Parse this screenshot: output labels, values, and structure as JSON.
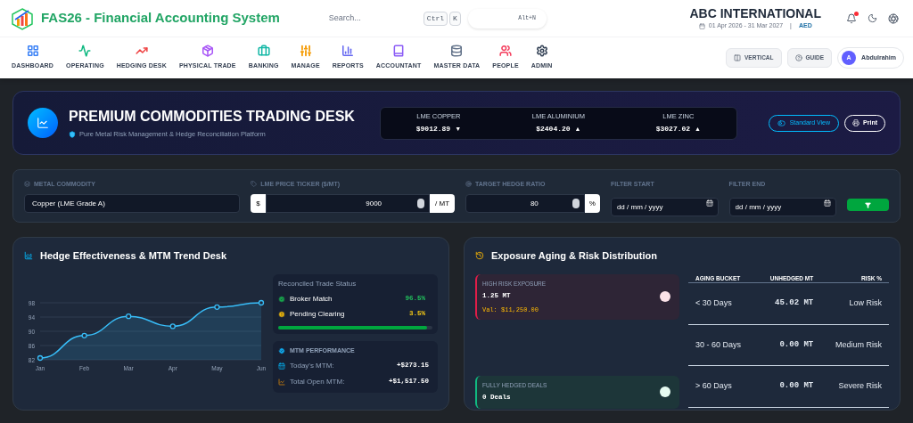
{
  "header": {
    "app_title": "FAS26 - Financial Accounting System",
    "search": {
      "placeholder": "Search...",
      "shortcut_keys": [
        "Ctrl",
        "K"
      ]
    },
    "quick_shortcut": "Alt+N",
    "company": "ABC INTERNATIONAL",
    "period": "01 Apr 2026 - 31 Mar 2027",
    "period_separator": "|",
    "currency": "AED",
    "has_notification": true
  },
  "nav": [
    {
      "label": "DASHBOARD",
      "color": "#3b82f6"
    },
    {
      "label": "OPERATING",
      "color": "#10b981"
    },
    {
      "label": "HEDGING DESK",
      "color": "#ef4444"
    },
    {
      "label": "PHYSICAL TRADE",
      "color": "#a855f7"
    },
    {
      "label": "BANKING",
      "color": "#14b8a6"
    },
    {
      "label": "MANAGE",
      "color": "#f59e0b"
    },
    {
      "label": "REPORTS",
      "color": "#6366f1"
    },
    {
      "label": "ACCOUNTANT",
      "color": "#8b5cf6"
    },
    {
      "label": "MASTER DATA",
      "color": "#64748b"
    },
    {
      "label": "PEOPLE",
      "color": "#f43f5e"
    },
    {
      "label": "ADMIN",
      "color": "#334155"
    }
  ],
  "nav_actions": {
    "vertical": "VERTICAL",
    "guide": "GUIDE",
    "user_initial": "A",
    "user_name": "Abdulrahim"
  },
  "hero": {
    "title": "PREMIUM COMMODITIES TRADING DESK",
    "subtitle": "Pure Metal Risk Management & Hedge Reconciliation Platform",
    "tickers": [
      {
        "label": "LME COPPER",
        "price": "$9012.89",
        "arrow": "▼"
      },
      {
        "label": "LME ALUMINIUM",
        "price": "$2404.20",
        "arrow": "▲"
      },
      {
        "label": "LME ZINC",
        "price": "$3027.02",
        "arrow": "▲"
      }
    ],
    "view_button": "Standard View",
    "print_button": "Print"
  },
  "filters": {
    "commodity": {
      "label": "METAL COMMODITY",
      "value": "Copper (LME Grade A)"
    },
    "price": {
      "label": "LME PRICE TICKER ($/MT)",
      "prefix": "$",
      "value": "9000",
      "suffix": "/ MT"
    },
    "ratio": {
      "label": "TARGET HEDGE RATIO",
      "value": "80",
      "suffix": "%"
    },
    "start": {
      "label": "FILTER START",
      "placeholder": "dd / mm / yyyy"
    },
    "end": {
      "label": "FILTER END",
      "placeholder": "dd / mm / yyyy"
    }
  },
  "trend_panel": {
    "title": "Hedge Effectiveness & MTM Trend Desk",
    "chart_data": {
      "type": "area",
      "categories": [
        "Jan",
        "Feb",
        "Mar",
        "Apr",
        "May",
        "Jun"
      ],
      "series": [
        {
          "color": "#38bdf8",
          "values": [
            82.5,
            88.8,
            94.2,
            91.4,
            96.8,
            98
          ]
        }
      ],
      "ylim": [
        82,
        98
      ],
      "grid": true,
      "yticks": [
        82,
        86,
        90,
        94,
        98
      ]
    },
    "status": {
      "title": "Reconciled Trade Status",
      "items": [
        {
          "kind": "ok",
          "label": "Broker Match",
          "value": "96.5%",
          "color": "#22c55e"
        },
        {
          "kind": "warn",
          "label": "Pending Clearing",
          "value": "3.5%",
          "color": "#facc15"
        }
      ],
      "level": 0.965
    },
    "mtm": {
      "title": "MTM PERFORMANCE",
      "rows": [
        {
          "kind": "today",
          "label": "Today's MTM:",
          "value": "+$273.15"
        },
        {
          "kind": "total",
          "label": "Total Open MTM:",
          "value": "+$1,517.50"
        }
      ]
    }
  },
  "risk_panel": {
    "title": "Exposure Aging & Risk Distribution",
    "cards": [
      {
        "kind": "high",
        "label": "HIGH RISK EXPOSURE",
        "value": "1.25 MT",
        "note": "Val: $11,250.00",
        "color": "#e11d48"
      },
      {
        "kind": "hedged",
        "label": "FULLY HEDGED DEALS",
        "value": "0 Deals",
        "color": "#10b981"
      }
    ],
    "table": {
      "columns": [
        "AGING BUCKET",
        "UNHEDGED MT",
        "RISK %"
      ],
      "rows": [
        [
          "< 30 Days",
          "45.02 MT",
          "Low Risk"
        ],
        [
          "30 - 60 Days",
          "0.00 MT",
          "Medium Risk"
        ],
        [
          "> 60 Days",
          "0.00 MT",
          "Severe Risk"
        ]
      ]
    }
  }
}
